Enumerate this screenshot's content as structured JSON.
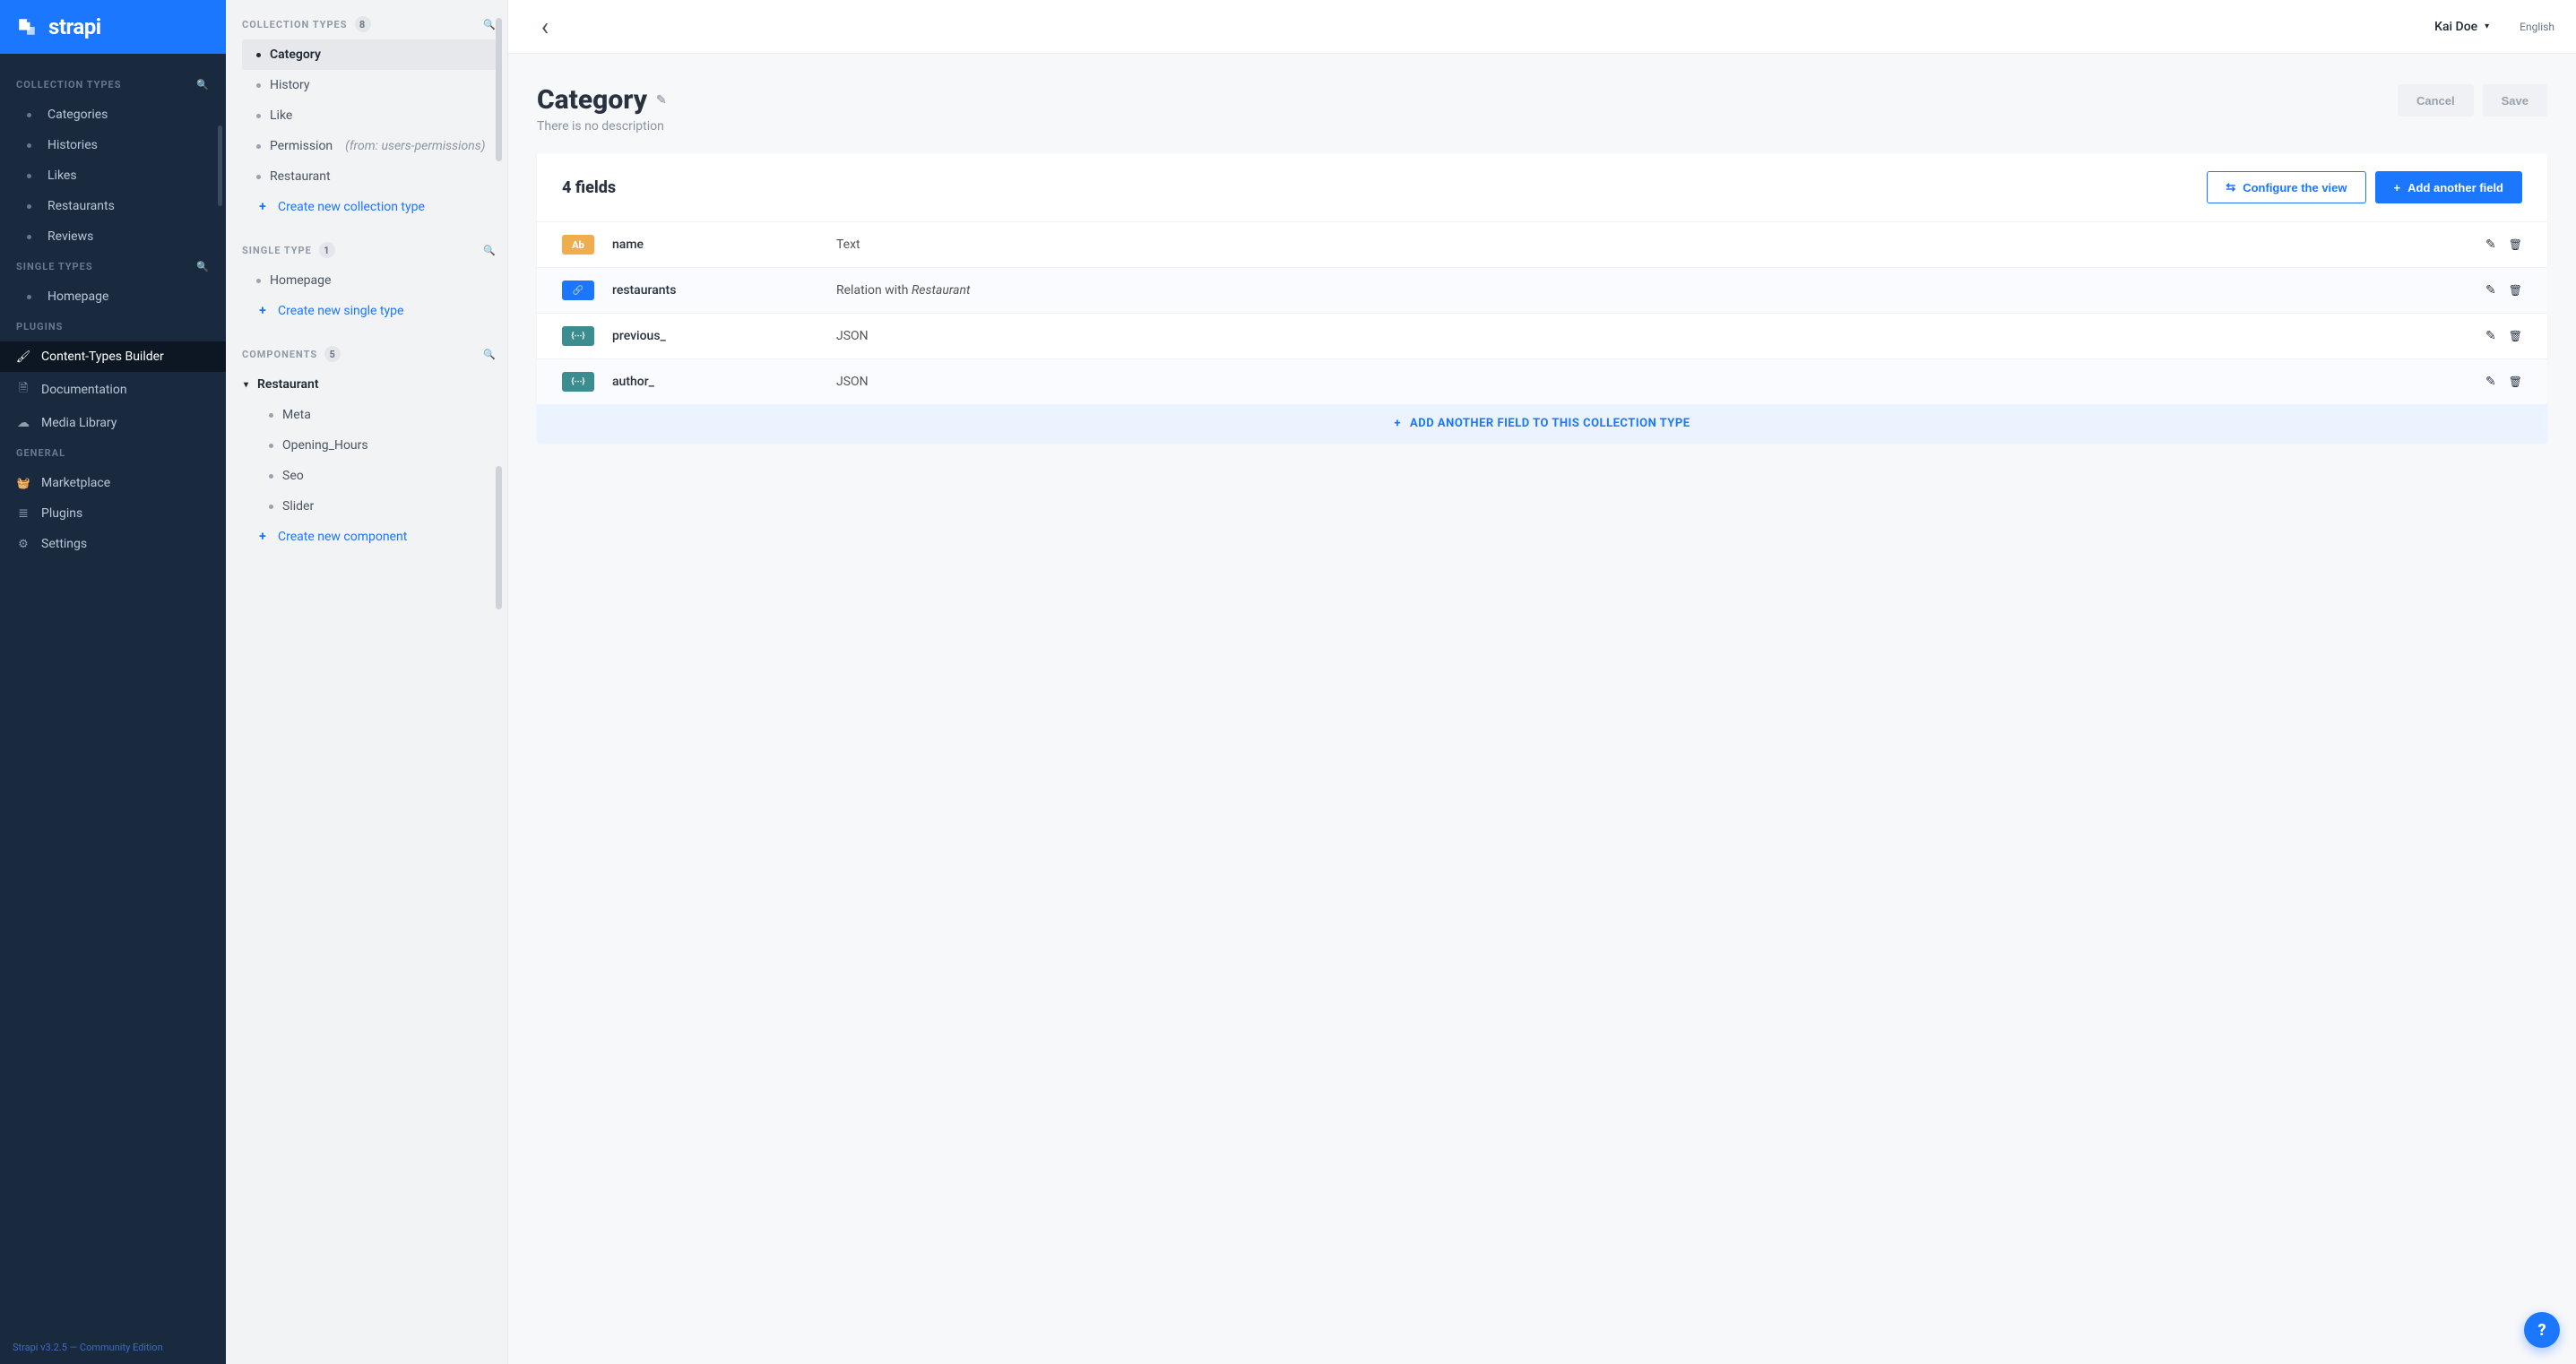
{
  "brand": "strapi",
  "topbar": {
    "user": "Kai Doe",
    "language": "English"
  },
  "sidebar": {
    "sections": {
      "collection_types": {
        "title": "COLLECTION TYPES",
        "items": [
          "Categories",
          "Histories",
          "Likes",
          "Restaurants",
          "Reviews"
        ]
      },
      "single_types": {
        "title": "SINGLE TYPES",
        "items": [
          "Homepage"
        ]
      },
      "plugins": {
        "title": "PLUGINS",
        "items": [
          "Content-Types Builder",
          "Documentation",
          "Media Library"
        ]
      },
      "general": {
        "title": "GENERAL",
        "items": [
          "Marketplace",
          "Plugins",
          "Settings"
        ]
      }
    },
    "footer": "Strapi v3.2.5 — Community Edition"
  },
  "midpanel": {
    "collection": {
      "title": "COLLECTION TYPES",
      "count": "8",
      "items": [
        {
          "label": "Category",
          "active": true
        },
        {
          "label": "History"
        },
        {
          "label": "Like"
        },
        {
          "label": "Permission",
          "origin": "(from: users-permissions)"
        },
        {
          "label": "Restaurant"
        }
      ],
      "create": "Create new collection type"
    },
    "single": {
      "title": "SINGLE TYPE",
      "count": "1",
      "items": [
        {
          "label": "Homepage"
        }
      ],
      "create": "Create new single type"
    },
    "components": {
      "title": "COMPONENTS",
      "count": "5",
      "group": "Restaurant",
      "items": [
        {
          "label": "Meta"
        },
        {
          "label": "Opening_Hours"
        },
        {
          "label": "Seo"
        },
        {
          "label": "Slider"
        }
      ],
      "create": "Create new component"
    }
  },
  "page": {
    "title": "Category",
    "description": "There is no description",
    "cancel": "Cancel",
    "save": "Save",
    "fields_heading": "4 fields",
    "configure": "Configure the view",
    "add_field": "Add another field",
    "add_footer": "ADD ANOTHER FIELD TO THIS COLLECTION TYPE",
    "fields": [
      {
        "badge": "Ab",
        "badgeClass": "tb-text",
        "name": "name",
        "type": "Text",
        "relWith": ""
      },
      {
        "badge": "link",
        "badgeClass": "tb-rel",
        "name": "restaurants",
        "type": "Relation with ",
        "relWith": "Restaurant"
      },
      {
        "badge": "json",
        "badgeClass": "tb-json",
        "name": "previous_",
        "type": "JSON",
        "relWith": ""
      },
      {
        "badge": "json",
        "badgeClass": "tb-json",
        "name": "author_",
        "type": "JSON",
        "relWith": ""
      }
    ]
  }
}
